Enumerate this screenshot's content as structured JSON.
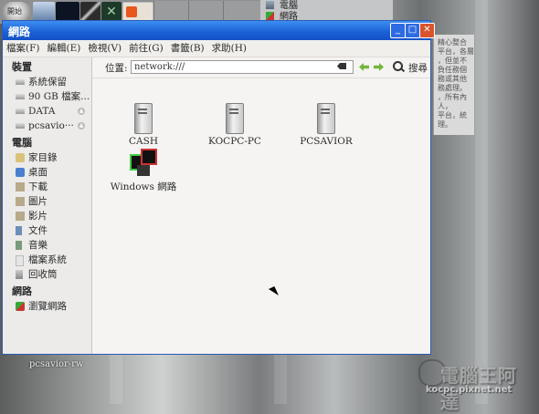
{
  "taskbar": {
    "start_label": "開始",
    "places": [
      {
        "label": "電腦",
        "icon": "computer-icon"
      },
      {
        "label": "網路",
        "icon": "network-icon"
      }
    ]
  },
  "background_doc": {
    "lines": [
      "精心整合",
      "平台，各層",
      "，但並不",
      "負任務個",
      "務或其他",
      "務處理。",
      "，所有內",
      "人，",
      "平台，統",
      "理。"
    ]
  },
  "window": {
    "title": "網路",
    "menu": [
      "檔案(F)",
      "編輯(E)",
      "檢視(V)",
      "前往(G)",
      "書籤(B)",
      "求助(H)"
    ],
    "sidebar": {
      "devices_header": "裝置",
      "devices": [
        {
          "label": "系統保留",
          "icon": "drive-icon",
          "eject": false
        },
        {
          "label": "90 GB 檔案...",
          "icon": "drive-icon",
          "eject": false
        },
        {
          "label": "DATA",
          "icon": "drive-icon",
          "eject": true
        },
        {
          "label": "pcsavio···",
          "icon": "drive-icon",
          "eject": true
        }
      ],
      "computer_header": "電腦",
      "computer": [
        {
          "label": "家目錄",
          "icon": "home-icon"
        },
        {
          "label": "桌面",
          "icon": "desktop-icon"
        },
        {
          "label": "下載",
          "icon": "folder-icon"
        },
        {
          "label": "圖片",
          "icon": "folder-icon"
        },
        {
          "label": "影片",
          "icon": "folder-icon"
        },
        {
          "label": "文件",
          "icon": "document-icon"
        },
        {
          "label": "音樂",
          "icon": "music-icon"
        },
        {
          "label": "檔案系統",
          "icon": "filesystem-icon"
        },
        {
          "label": "回收筒",
          "icon": "trash-icon"
        }
      ],
      "network_header": "網路",
      "network": [
        {
          "label": "瀏覽網路",
          "icon": "network-icon"
        }
      ]
    },
    "location": {
      "label": "位置:",
      "value": "network:///",
      "search_label": "搜尋"
    },
    "items": [
      {
        "label": "CASH",
        "icon": "computer-icon"
      },
      {
        "label": "KOCPC-PC",
        "icon": "computer-icon"
      },
      {
        "label": "PCSAVIOR",
        "icon": "computer-icon"
      },
      {
        "label": "Windows 網路",
        "icon": "windows-network-icon"
      }
    ]
  },
  "desktop": {
    "label": "pcsavior-rw"
  },
  "watermark": {
    "text": "電腦王阿達",
    "url": "kocpc.pixnet.net"
  },
  "colors": {
    "titlebar": "#1a5fd5",
    "close_button": "#d9542c",
    "arrows": "#73b53c"
  }
}
